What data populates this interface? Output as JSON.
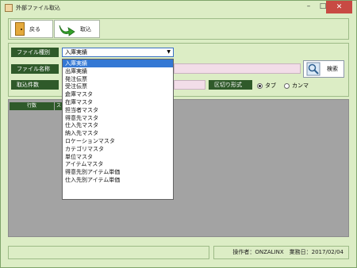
{
  "window": {
    "title": "外部ファイル取込",
    "minimize": "–",
    "maximize": "□",
    "close": "✕"
  },
  "toolbar": {
    "back_label": "戻る",
    "import_label": "取込"
  },
  "form": {
    "file_type_label": "ファイル種別",
    "file_type_value": "入庫実績",
    "file_name_label": "ファイル名称",
    "import_count_label": "取込件数",
    "search_label": "検索",
    "delimiter_label": "区切り形式",
    "delimiter_options": [
      "タブ",
      "カンマ"
    ],
    "delimiter_selected": "タブ"
  },
  "grid": {
    "headers": [
      "行数",
      "ス"
    ]
  },
  "dropdown": {
    "items": [
      "入庫実績",
      "出庫実績",
      "発注伝票",
      "受注伝票",
      "倉庫マスタ",
      "在庫マスタ",
      "担当者マスタ",
      "得意先マスタ",
      "仕入先マスタ",
      "納入先マスタ",
      "ロケーションマスタ",
      "カテゴリマスタ",
      "単位マスタ",
      "アイテムマスタ",
      "得意先別アイテム単価",
      "仕入先別アイテム単価"
    ],
    "selected_index": 0
  },
  "status": {
    "left": "",
    "right": "操作者：ONZALINX　業務日：2017/02/04"
  }
}
